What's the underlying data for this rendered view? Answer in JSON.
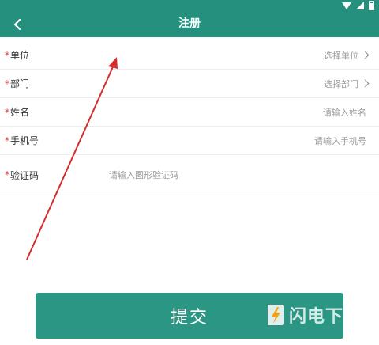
{
  "header": {
    "title": "注册"
  },
  "form": {
    "required_mark": "*",
    "unit": {
      "label": "单位",
      "value": "选择单位"
    },
    "department": {
      "label": "部门",
      "value": "选择部门"
    },
    "name": {
      "label": "姓名",
      "placeholder": "请输入姓名"
    },
    "phone": {
      "label": "手机号",
      "placeholder": "请输入手机号"
    },
    "captcha": {
      "label": "验证码",
      "placeholder": "请输入图形验证码"
    }
  },
  "submit_label": "提交",
  "watermark": {
    "text": "闪电下载"
  },
  "colors": {
    "accent": "#24907d",
    "button": "#2c9684",
    "required": "#e53935",
    "annotation_arrow": "#d42d2d"
  }
}
